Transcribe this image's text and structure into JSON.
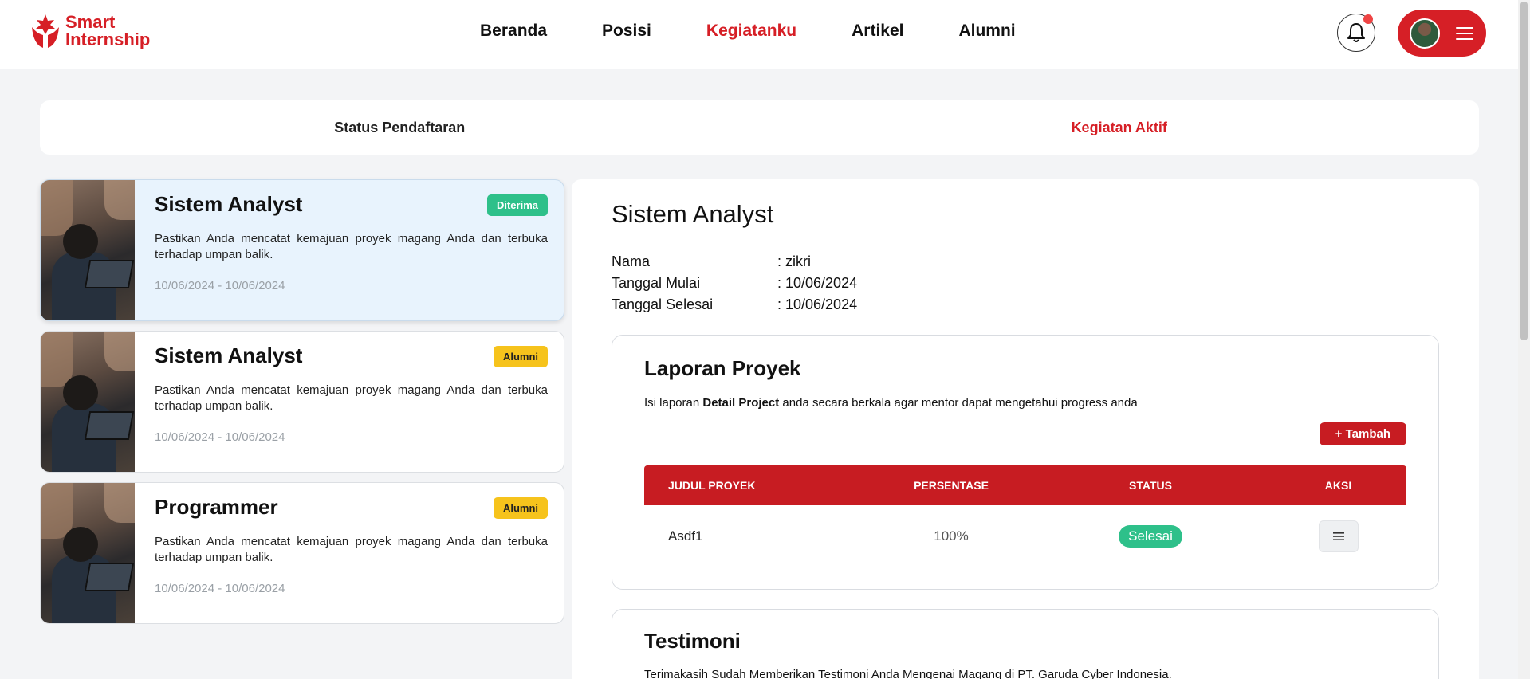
{
  "header": {
    "logo_line1": "Smart",
    "logo_line2": "Internship",
    "nav": [
      "Beranda",
      "Posisi",
      "Kegiatanku",
      "Artikel",
      "Alumni"
    ],
    "active_nav": "Kegiatanku"
  },
  "tabs": {
    "status": "Status Pendaftaran",
    "aktif": "Kegiatan Aktif"
  },
  "cards": [
    {
      "title": "Sistem Analyst",
      "badge": "Diterima",
      "desc": "Pastikan Anda mencatat kemajuan proyek magang Anda dan terbuka terhadap umpan balik.",
      "date": "10/06/2024 - 10/06/2024"
    },
    {
      "title": "Sistem Analyst",
      "badge": "Alumni",
      "desc": "Pastikan Anda mencatat kemajuan proyek magang Anda dan terbuka terhadap umpan balik.",
      "date": "10/06/2024 - 10/06/2024"
    },
    {
      "title": "Programmer",
      "badge": "Alumni",
      "desc": "Pastikan Anda mencatat kemajuan proyek magang Anda dan terbuka terhadap umpan balik.",
      "date": "10/06/2024 - 10/06/2024"
    }
  ],
  "detail": {
    "title": "Sistem Analyst",
    "info": [
      {
        "key": "Nama",
        "value": ": zikri"
      },
      {
        "key": "Tanggal Mulai",
        "value": ": 10/06/2024"
      },
      {
        "key": "Tanggal Selesai",
        "value": ": 10/06/2024"
      }
    ],
    "laporan": {
      "title": "Laporan Proyek",
      "desc_prefix": "Isi laporan ",
      "desc_bold": "Detail Project",
      "desc_suffix": " anda secara berkala agar mentor dapat mengetahui progress anda",
      "add_label": "+ Tambah",
      "columns": [
        "JUDUL PROYEK",
        "PERSENTASE",
        "STATUS",
        "AKSI"
      ],
      "rows": [
        {
          "judul": "Asdf1",
          "persentase": "100%",
          "status": "Selesai"
        }
      ]
    },
    "testimoni": {
      "title": "Testimoni",
      "text": "Terimakasih Sudah Memberikan Testimoni Anda Mengenai Magang di PT. Garuda Cyber Indonesia."
    }
  },
  "colors": {
    "brand": "#d61f26",
    "table_header": "#c71c22",
    "success": "#2ec08a",
    "warning": "#f6c31c",
    "selected_card": "#e8f3fd"
  }
}
